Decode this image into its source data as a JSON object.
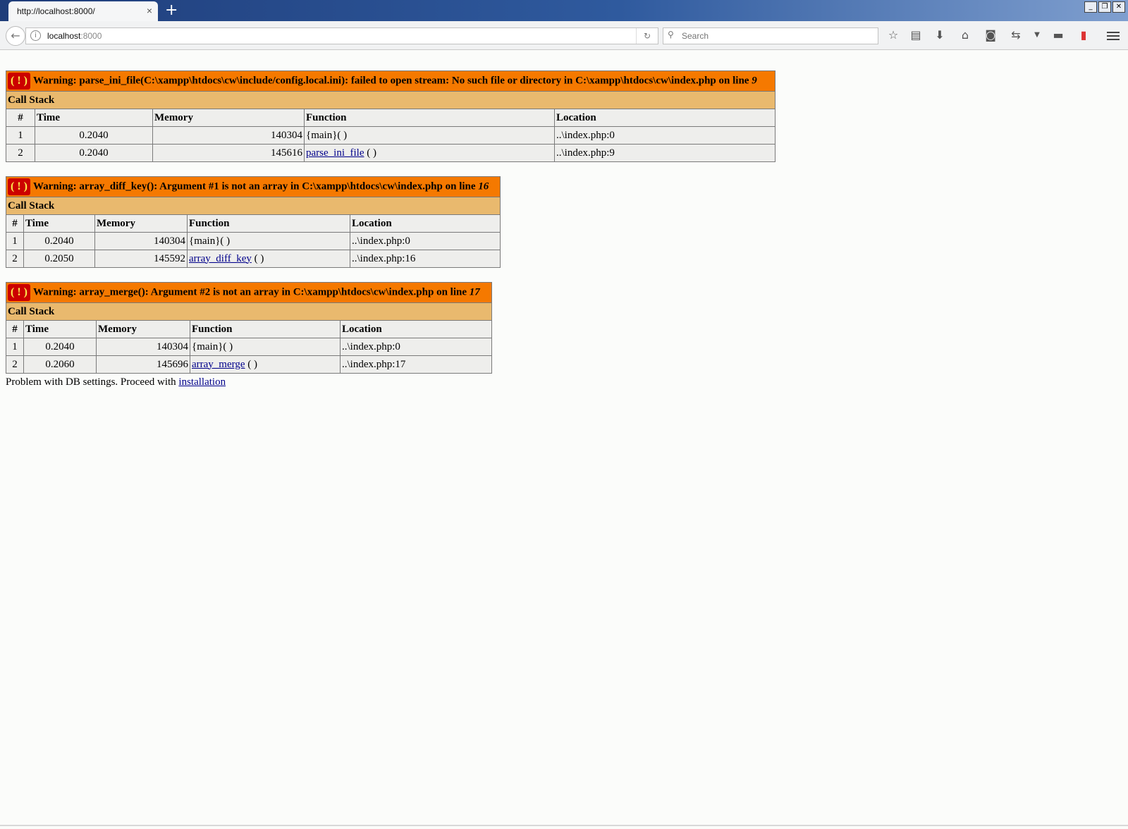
{
  "browser": {
    "tab_title": "http://localhost:8000/",
    "tab_close": "×",
    "new_tab": "+",
    "url_host": "localhost",
    "url_port": ":8000",
    "search_placeholder": "Search",
    "window_controls": [
      "_",
      "❐",
      "✕"
    ]
  },
  "warnings": [
    {
      "message": "Warning: parse_ini_file(C:\\xampp\\htdocs\\cw\\include/config.local.ini): failed to open stream: No such file or directory in C:\\xampp\\htdocs\\cw\\index.php on line ",
      "line": "9",
      "stack_title": "Call Stack",
      "headers": [
        "#",
        "Time",
        "Memory",
        "Function",
        "Location"
      ],
      "rows": [
        {
          "num": "1",
          "time": "0.2040",
          "memory": "140304",
          "function": "{main}( )",
          "function_link": "",
          "location": "..\\index.php:0"
        },
        {
          "num": "2",
          "time": "0.2040",
          "memory": "145616",
          "function": " ( )",
          "function_link": "parse_ini_file",
          "location": "..\\index.php:9"
        }
      ]
    },
    {
      "message": "Warning: array_diff_key(): Argument #1 is not an array in C:\\xampp\\htdocs\\cw\\index.php on line ",
      "line": "16",
      "stack_title": "Call Stack",
      "headers": [
        "#",
        "Time",
        "Memory",
        "Function",
        "Location"
      ],
      "rows": [
        {
          "num": "1",
          "time": "0.2040",
          "memory": "140304",
          "function": "{main}( )",
          "function_link": "",
          "location": "..\\index.php:0"
        },
        {
          "num": "2",
          "time": "0.2050",
          "memory": "145592",
          "function": " ( )",
          "function_link": "array_diff_key",
          "location": "..\\index.php:16"
        }
      ]
    },
    {
      "message": "Warning: array_merge(): Argument #2 is not an array in C:\\xampp\\htdocs\\cw\\index.php on line ",
      "line": "17",
      "stack_title": "Call Stack",
      "headers": [
        "#",
        "Time",
        "Memory",
        "Function",
        "Location"
      ],
      "rows": [
        {
          "num": "1",
          "time": "0.2040",
          "memory": "140304",
          "function": "{main}( )",
          "function_link": "",
          "location": "..\\index.php:0"
        },
        {
          "num": "2",
          "time": "0.2060",
          "memory": "145696",
          "function": " ( )",
          "function_link": "array_merge",
          "location": "..\\index.php:17"
        }
      ]
    }
  ],
  "footer": {
    "text": "Problem with DB settings. Proceed with ",
    "link": "installation"
  },
  "colors": {
    "warning_header": "#f57900",
    "call_stack_header": "#e9b96e",
    "cell_background": "#eeeeec",
    "warning_icon": "#cc0000"
  }
}
